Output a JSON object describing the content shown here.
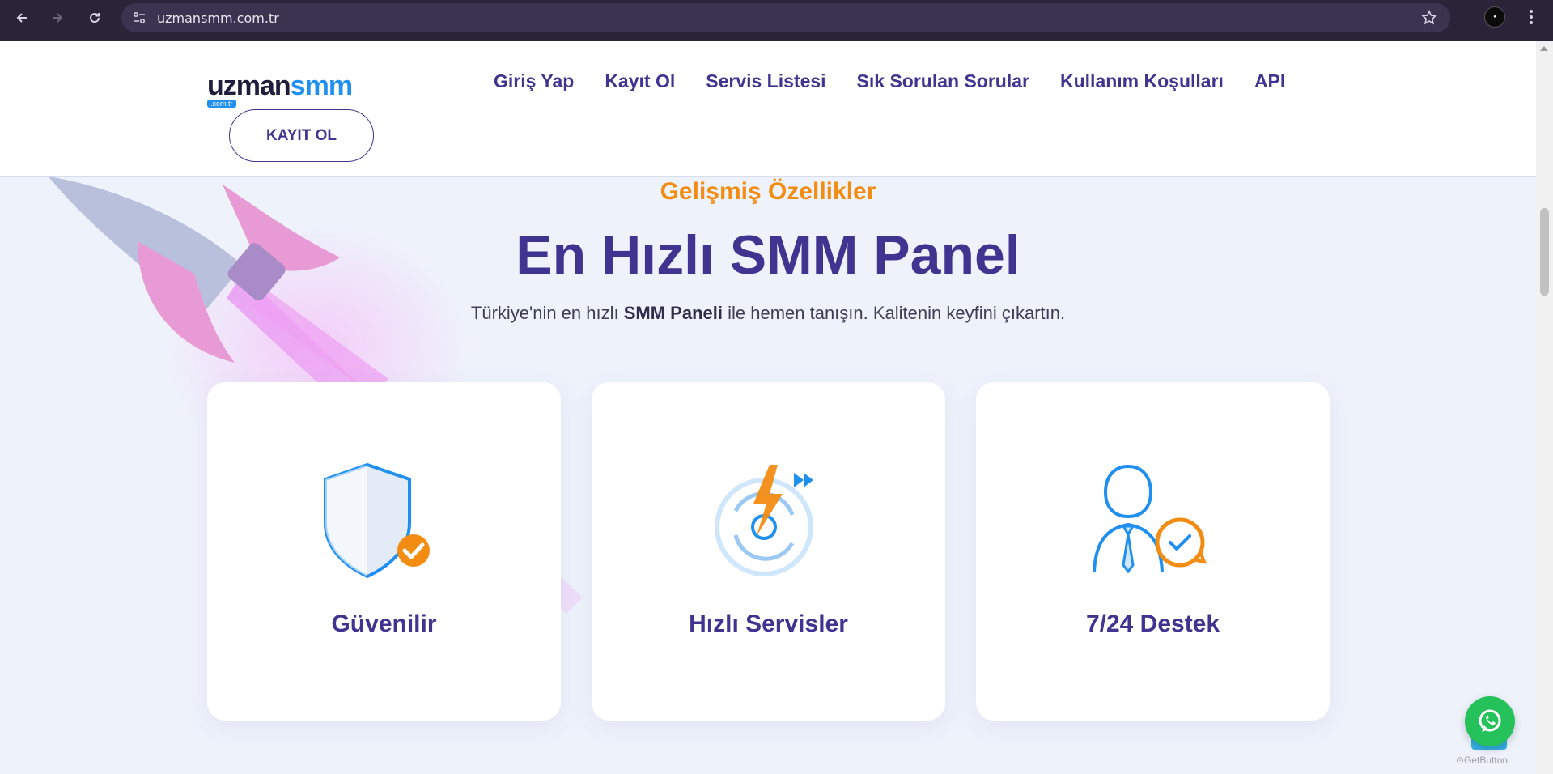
{
  "browser": {
    "url": "uzmansmm.com.tr",
    "icons": {
      "back": "arrow-left-icon",
      "forward": "arrow-right-icon",
      "reload": "reload-icon",
      "site_info": "tune-icon",
      "bookmark": "star-icon",
      "profile": "avatar",
      "menu": "kebab-menu-icon"
    }
  },
  "header": {
    "logo": {
      "part1": "uzman",
      "part2": "smm",
      "tld": ".com.tr"
    },
    "nav": [
      {
        "label": "Giriş Yap"
      },
      {
        "label": "Kayıt Ol"
      },
      {
        "label": "Servis Listesi"
      },
      {
        "label": "Sık Sorulan Sorular"
      },
      {
        "label": "Kullanım Koşulları"
      },
      {
        "label": "API"
      }
    ],
    "register_button": "KAYIT OL"
  },
  "hero": {
    "eyebrow": "Gelişmiş Özellikler",
    "title": "En Hızlı SMM Panel",
    "subtitle_before": "Türkiye'nin en hızlı ",
    "subtitle_bold": "SMM Paneli",
    "subtitle_after": " ile hemen tanışın. Kalitenin keyfini çıkartın."
  },
  "features": [
    {
      "title": "Güvenilir",
      "icon": "shield-check-icon"
    },
    {
      "title": "Hızlı Servisler",
      "icon": "lightning-speed-icon"
    },
    {
      "title": "7/24 Destek",
      "icon": "support-agent-icon"
    }
  ],
  "widget": {
    "label": "GetButton",
    "icon": "whatsapp-icon"
  },
  "colors": {
    "brand_primary": "#3f3490",
    "accent_orange": "#f28c12",
    "accent_blue": "#1f8ff0",
    "whatsapp_green": "#25c15a"
  }
}
